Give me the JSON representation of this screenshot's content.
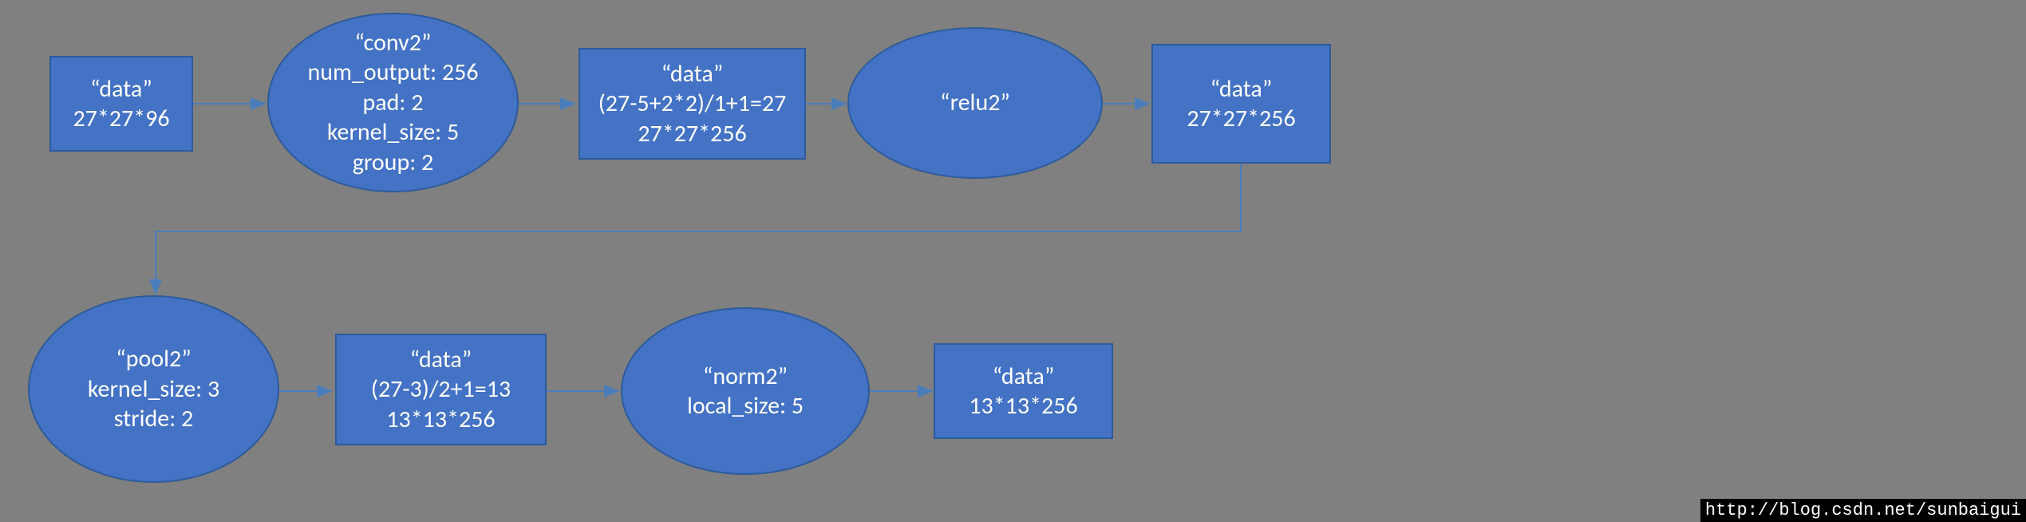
{
  "nodes": {
    "data1": {
      "lines": [
        "“data”",
        "27*27*96"
      ]
    },
    "conv2": {
      "lines": [
        "“conv2”",
        "num_output: 256",
        "pad: 2",
        "kernel_size: 5",
        "group: 2"
      ]
    },
    "data2": {
      "lines": [
        "“data”",
        "(27-5+2*2)/1+1=27",
        "27*27*256"
      ]
    },
    "relu2": {
      "lines": [
        "“relu2”"
      ]
    },
    "data3": {
      "lines": [
        "“data”",
        "27*27*256"
      ]
    },
    "pool2": {
      "lines": [
        "“pool2”",
        "kernel_size: 3",
        "stride: 2"
      ]
    },
    "data4": {
      "lines": [
        "“data”",
        "(27-3)/2+1=13",
        "13*13*256"
      ]
    },
    "norm2": {
      "lines": [
        "“norm2”",
        "local_size: 5"
      ]
    },
    "data5": {
      "lines": [
        "“data”",
        "13*13*256"
      ]
    }
  },
  "watermark": "http://blog.csdn.net/sunbaigui"
}
